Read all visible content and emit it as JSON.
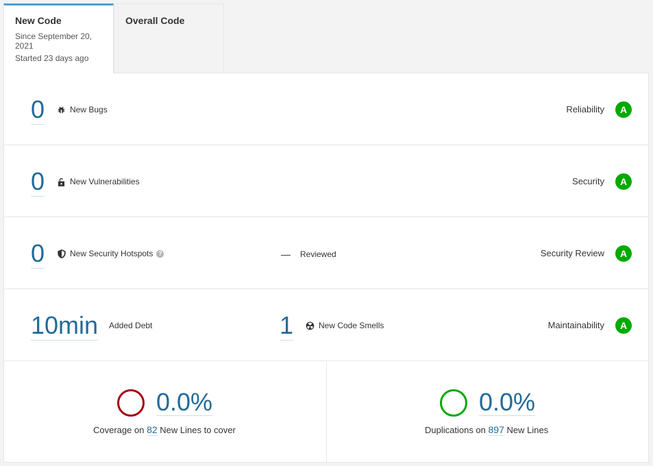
{
  "tabs": {
    "new_code": {
      "title": "New Code",
      "since": "Since September 20, 2021",
      "started": "Started 23 days ago"
    },
    "overall_code": {
      "title": "Overall Code"
    }
  },
  "rows": [
    {
      "value": "0",
      "label": "New Bugs",
      "icon": "bug-icon",
      "rating_name": "Reliability",
      "rating": "A"
    },
    {
      "value": "0",
      "label": "New Vulnerabilities",
      "icon": "lock-icon",
      "rating_name": "Security",
      "rating": "A"
    },
    {
      "value": "0",
      "label": "New Security Hotspots",
      "icon": "shield-icon",
      "help": "?",
      "middle_value": "—",
      "middle_label": "Reviewed",
      "rating_name": "Security Review",
      "rating": "A"
    },
    {
      "value": "10min",
      "label": "Added Debt",
      "middle_value": "1",
      "middle_label": "New Code Smells",
      "middle_icon": "code-smell-icon",
      "rating_name": "Maintainability",
      "rating": "A"
    }
  ],
  "coverage": {
    "percent": "0.0%",
    "prefix": "Coverage on",
    "lines": "82",
    "suffix": "New Lines to cover",
    "circle_color": "#a4030f"
  },
  "duplications": {
    "percent": "0.0%",
    "prefix": "Duplications on",
    "lines": "897",
    "suffix": "New Lines",
    "circle_color": "#00aa00"
  },
  "colors": {
    "rating_a": "#00aa00",
    "link": "#236a97",
    "tab_accent": "#4b9fd5"
  }
}
